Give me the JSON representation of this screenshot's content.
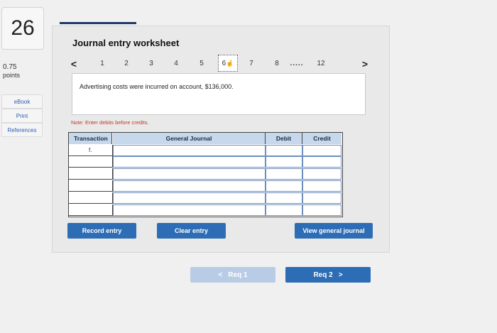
{
  "question": {
    "number": "26",
    "points_value": "0.75",
    "points_label": "points"
  },
  "sidebar": {
    "links": [
      "eBook",
      "Print",
      "References"
    ]
  },
  "worksheet": {
    "title": "Journal entry worksheet",
    "pager": {
      "prev": "<",
      "pages": [
        "1",
        "2",
        "3",
        "4",
        "5",
        "6",
        "7",
        "8"
      ],
      "ellipsis": ".....",
      "last": "12",
      "next": ">",
      "active": "6"
    },
    "description": "Advertising costs were incurred on account, $136,000.",
    "note": "Note: Enter debits before credits.",
    "table": {
      "headers": [
        "Transaction",
        "General Journal",
        "Debit",
        "Credit"
      ],
      "rows": [
        {
          "transaction": "f.",
          "account": "",
          "debit": "",
          "credit": ""
        },
        {
          "transaction": "",
          "account": "",
          "debit": "",
          "credit": ""
        },
        {
          "transaction": "",
          "account": "",
          "debit": "",
          "credit": ""
        },
        {
          "transaction": "",
          "account": "",
          "debit": "",
          "credit": ""
        },
        {
          "transaction": "",
          "account": "",
          "debit": "",
          "credit": ""
        },
        {
          "transaction": "",
          "account": "",
          "debit": "",
          "credit": ""
        }
      ]
    },
    "buttons": {
      "record": "Record entry",
      "clear": "Clear entry",
      "view": "View general journal"
    }
  },
  "navigation": {
    "prev_label": "Req 1",
    "next_label": "Req 2",
    "prev_arrow": "<",
    "next_arrow": ">"
  },
  "colors": {
    "accent": "#2d6db5",
    "header_bg": "#c7d8ec",
    "note": "#c0392b",
    "disabled": "#b9cce6"
  }
}
